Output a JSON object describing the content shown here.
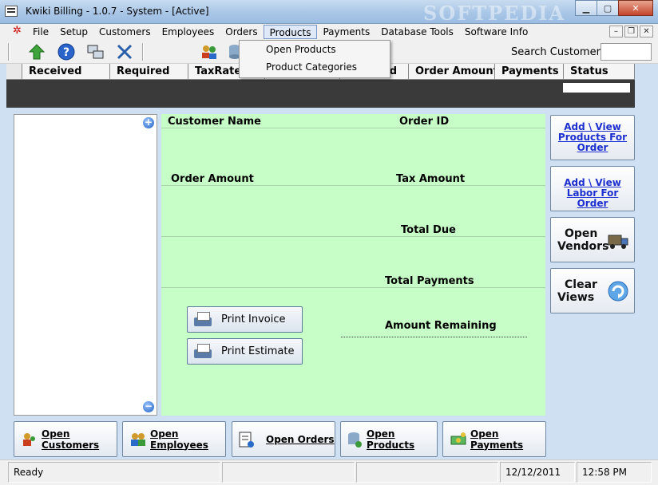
{
  "window": {
    "title": "Kwiki Billing - 1.0.7 - System - [Active]",
    "watermark": "SOFTPEDIA",
    "minimize": "▁",
    "maximize": "▢",
    "close": "✕"
  },
  "menu": {
    "items": [
      "File",
      "Setup",
      "Customers",
      "Employees",
      "Orders",
      "Products",
      "Payments",
      "Database Tools",
      "Software Info"
    ],
    "active": "Products",
    "mdi_minimize": "–",
    "mdi_restore": "❐",
    "mdi_close": "✕"
  },
  "products_menu": {
    "items": [
      "Open Products",
      "Product Categories"
    ]
  },
  "toolbar": {
    "icons": [
      "up-arrow-icon",
      "help-icon",
      "network-icon",
      "tools-icon",
      "users-icon",
      "database-icon"
    ],
    "search_label": "Search Customer :",
    "search_value": ""
  },
  "grid": {
    "columns": [
      "Received",
      "Required",
      "TaxRate %",
      "",
      "d",
      "Order Amount",
      "Payments",
      "Status"
    ]
  },
  "details": {
    "customer_name": "Customer Name",
    "order_id": "Order ID",
    "order_amount": "Order Amount",
    "tax_amount": "Tax Amount",
    "total_due": "Total Due",
    "total_payments": "Total Payments",
    "amount_remaining": "Amount Remaining",
    "print_invoice": "Print Invoice",
    "print_estimate": "Print Estimate"
  },
  "side_buttons": {
    "products_line1": "Add \\ View",
    "products_line2": "Products For",
    "products_line3": "Order",
    "labor_line1": "Add \\ View",
    "labor_line2": "Labor For Order",
    "vendors_line1": "Open",
    "vendors_line2": "Vendors",
    "clear_line1": "Clear",
    "clear_line2": "Views"
  },
  "bottom_buttons": {
    "customers": "Open Customers",
    "employees": "Open Employees",
    "orders": "Open Orders",
    "products": "Open Products",
    "payments": "Open Payments"
  },
  "status": {
    "text": "Ready",
    "date": "12/12/2011",
    "time": "12:58 PM"
  },
  "colors": {
    "detail_bg": "#c7fdc6",
    "side_link": "#1d2fcf",
    "grid_bg": "#3a3a3a"
  }
}
